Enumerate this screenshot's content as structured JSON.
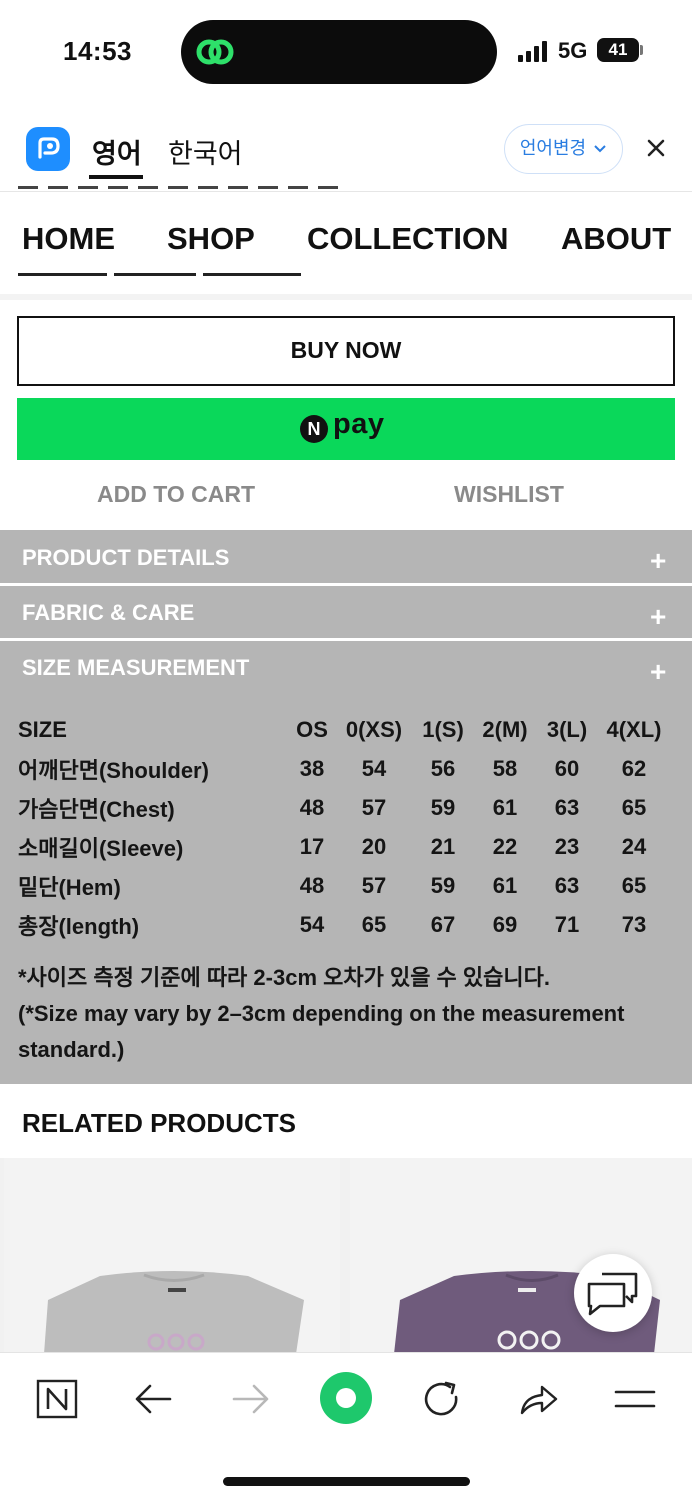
{
  "status_bar": {
    "time": "14:53",
    "network": "5G",
    "battery": "41"
  },
  "translate_bar": {
    "tab_english": "영어",
    "tab_korean": "한국어",
    "language_change": "언어변경"
  },
  "nav": {
    "items": [
      "HOME",
      "SHOP",
      "COLLECTION",
      "ABOUT"
    ]
  },
  "buttons": {
    "buy_now": "BUY NOW",
    "npay_n": "N",
    "npay_word": "pay",
    "add_to_cart": "ADD TO CART",
    "wishlist": "WISHLIST"
  },
  "accordion": {
    "product_details": "PRODUCT DETAILS",
    "fabric_care": "FABRIC & CARE",
    "size_measurement": "SIZE MEASUREMENT",
    "plus": "+"
  },
  "size_table": {
    "header": [
      "SIZE",
      "OS",
      "0(XS)",
      "1(S)",
      "2(M)",
      "3(L)",
      "4(XL)"
    ],
    "rows": [
      [
        "어깨단면(Shoulder)",
        "38",
        "54",
        "56",
        "58",
        "60",
        "62"
      ],
      [
        "가슴단면(Chest)",
        "48",
        "57",
        "59",
        "61",
        "63",
        "65"
      ],
      [
        "소매길이(Sleeve)",
        "17",
        "20",
        "21",
        "22",
        "23",
        "24"
      ],
      [
        "밑단(Hem)",
        "48",
        "57",
        "59",
        "61",
        "63",
        "65"
      ],
      [
        "총장(length)",
        "54",
        "65",
        "67",
        "69",
        "71",
        "73"
      ]
    ],
    "note_korean": "*사이즈 측정 기준에 따라 2-3cm 오차가 있을 수 있습니다.",
    "note_english": "(*Size may vary by 2–3cm depending on the measurement standard.)"
  },
  "related": {
    "title": "RELATED PRODUCTS"
  },
  "colors": {
    "accordion_bg": "#b5b5b5",
    "npay_green": "#0ad85a",
    "papago_blue": "#1e8eff",
    "naver_green": "#1ec86c"
  },
  "icons": [
    "island-app-icon",
    "signal-icon",
    "papago-logo-icon",
    "chevron-down-icon",
    "close-icon",
    "chat-icon",
    "naver-n-icon",
    "back-arrow-icon",
    "forward-arrow-icon",
    "naver-green-dot-icon",
    "refresh-icon",
    "share-icon",
    "menu-icon"
  ]
}
